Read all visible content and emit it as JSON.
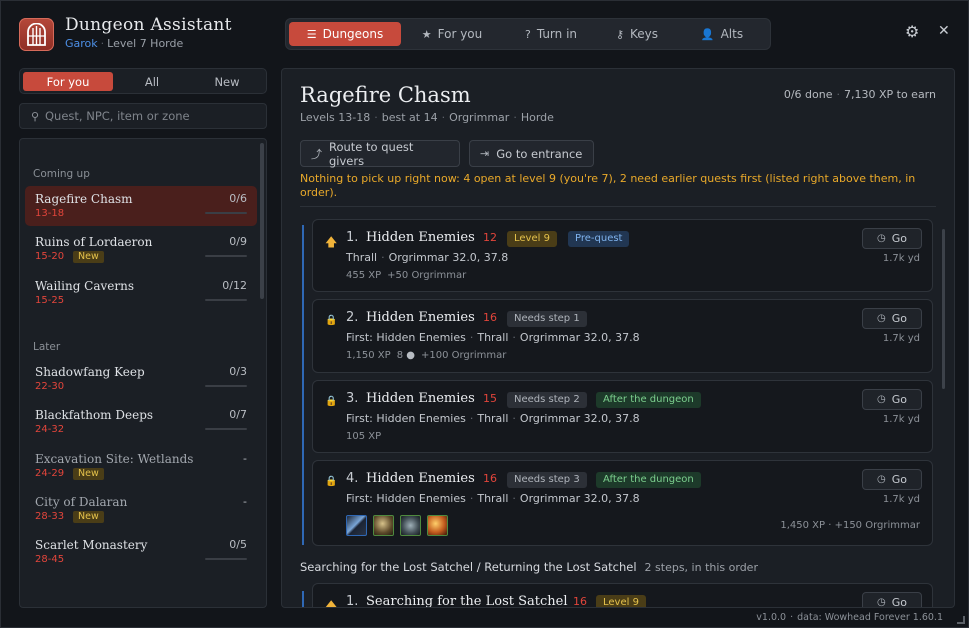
{
  "header": {
    "title": "Dungeon Assistant",
    "character": "Garok",
    "level_faction": "Level 7 Horde",
    "logo_icon": "dungeon-gate-icon",
    "accent": "#c74a3c"
  },
  "nav": {
    "tabs": [
      {
        "label": "Dungeons",
        "icon": "list-icon",
        "active": true
      },
      {
        "label": "For you",
        "icon": "star-icon",
        "active": false
      },
      {
        "label": "Turn in",
        "icon": "question-icon",
        "active": false
      },
      {
        "label": "Keys",
        "icon": "key-icon",
        "active": false
      },
      {
        "label": "Alts",
        "icon": "person-icon",
        "active": false
      }
    ]
  },
  "sidebar": {
    "filters": [
      {
        "label": "For you",
        "active": true
      },
      {
        "label": "All",
        "active": false
      },
      {
        "label": "New",
        "active": false
      }
    ],
    "search_placeholder": "Quest, NPC, item or zone",
    "groups": [
      {
        "heading": "Coming up",
        "items": [
          {
            "name": "Ragefire Chasm",
            "range": "13-18",
            "count": "0/6",
            "active": true,
            "new": false
          },
          {
            "name": "Ruins of Lordaeron",
            "range": "15-20",
            "count": "0/9",
            "active": false,
            "new": true
          },
          {
            "name": "Wailing Caverns",
            "range": "15-25",
            "count": "0/12",
            "active": false,
            "new": false
          }
        ]
      },
      {
        "heading": "Later",
        "items": [
          {
            "name": "Shadowfang Keep",
            "range": "22-30",
            "count": "0/3",
            "active": false,
            "new": false
          },
          {
            "name": "Blackfathom Deeps",
            "range": "24-32",
            "count": "0/7",
            "active": false,
            "new": false
          },
          {
            "name": "Excavation Site: Wetlands",
            "range": "24-29",
            "count": "-",
            "active": false,
            "new": true
          },
          {
            "name": "City of Dalaran",
            "range": "28-33",
            "count": "-",
            "active": false,
            "new": true
          },
          {
            "name": "Scarlet Monastery",
            "range": "28-45",
            "count": "0/5",
            "active": false,
            "new": false
          }
        ]
      }
    ],
    "new_label": "New"
  },
  "main": {
    "title": "Ragefire Chasm",
    "meta": {
      "levels": "Levels 13-18",
      "best": "best at 14",
      "city": "Orgrimmar",
      "faction": "Horde"
    },
    "stats": {
      "done": "0/6 done",
      "xp": "7,130 XP to earn"
    },
    "buttons": {
      "route": "Route to quest givers",
      "entrance": "Go to entrance"
    },
    "notice": "Nothing to pick up right now: 4 open at level 9 (you're 7), 2 need earlier quests first (listed right above them, in order).",
    "go_label": "Go",
    "steps": [
      {
        "num": "1.",
        "name": "Hidden Enemies",
        "level": "12",
        "status": "up",
        "tags": [
          {
            "text": "Level 9",
            "style": "gold"
          },
          {
            "text": "Pre-quest",
            "style": "blue"
          }
        ],
        "line1": [
          "Thrall",
          "Orgrimmar 32.0, 37.8"
        ],
        "xp": "455 XP",
        "rep": "+50 Orgrimmar",
        "dist": "1.7k yd"
      },
      {
        "num": "2.",
        "name": "Hidden Enemies",
        "level": "16",
        "status": "lock",
        "tags": [
          {
            "text": "Needs step 1",
            "style": "gray"
          }
        ],
        "line1": [
          "First: Hidden Enemies",
          "Thrall",
          "Orgrimmar 32.0, 37.8"
        ],
        "xp": "1,150 XP",
        "money": "8",
        "rep": "+100 Orgrimmar",
        "dist": "1.7k yd"
      },
      {
        "num": "3.",
        "name": "Hidden Enemies",
        "level": "15",
        "status": "lock",
        "tags": [
          {
            "text": "Needs step 2",
            "style": "gray"
          },
          {
            "text": "After the dungeon",
            "style": "green"
          }
        ],
        "line1": [
          "First: Hidden Enemies",
          "Thrall",
          "Orgrimmar 32.0, 37.8"
        ],
        "xp": "105 XP",
        "dist": "1.7k yd"
      },
      {
        "num": "4.",
        "name": "Hidden Enemies",
        "level": "16",
        "status": "lock",
        "tags": [
          {
            "text": "Needs step 3",
            "style": "gray"
          },
          {
            "text": "After the dungeon",
            "style": "green"
          }
        ],
        "line1": [
          "First: Hidden Enemies",
          "Thrall",
          "Orgrimmar 32.0, 37.8"
        ],
        "rewards": "1,450 XP  ·  +150 Orgrimmar",
        "dist": "1.7k yd",
        "loot_icons": [
          "sword-icon",
          "beast-mount-icon",
          "wolf-icon",
          "flame-staff-icon"
        ]
      }
    ],
    "chain": {
      "title": "Searching for the Lost Satchel / Returning the Lost Satchel",
      "note": "2 steps, in this order",
      "first_step": {
        "num": "1.",
        "name": "Searching for the Lost Satchel",
        "level": "16",
        "tag": "Level 9"
      }
    }
  },
  "footer": {
    "version": "v1.0.0",
    "data": "data: Wowhead Forever 1.60.1"
  }
}
